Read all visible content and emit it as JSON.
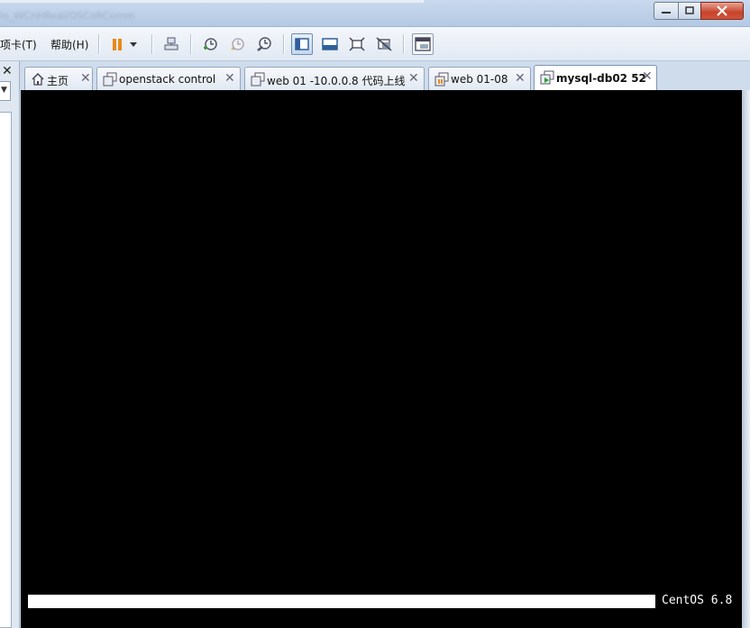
{
  "window": {
    "title": "lo_WCnHReal/OSCoRComm",
    "controls": {
      "minimize": "minimize",
      "maximize": "maximize",
      "close": "close"
    }
  },
  "menu": {
    "tabs_label": "项卡(T)",
    "help_label": "帮助(H)"
  },
  "toolbar": {
    "icons": [
      "pause-icon",
      "dropdown-arrow-icon",
      "send-ctrl-alt-del-icon",
      "snapshot-take-icon",
      "snapshot-revert-icon",
      "snapshot-manager-icon",
      "show-library-icon",
      "fullscreen-bar-icon",
      "fit-window-icon",
      "unity-icon",
      "console-view-icon"
    ]
  },
  "leftpane": {
    "close_glyph": "✕",
    "dropdown_glyph": "▼"
  },
  "tabs": [
    {
      "label": "主页",
      "icon": "home-icon",
      "close": "✕",
      "active": false
    },
    {
      "label": "openstack  control",
      "icon": "vm-icon",
      "close": "✕",
      "active": false
    },
    {
      "label": "web 01 -10.0.0.8  代码上线",
      "icon": "vm-icon",
      "close": "✕",
      "active": false
    },
    {
      "label": "web  01-08",
      "icon": "vm-paused-icon",
      "close": "✕",
      "active": false
    },
    {
      "label": "mysql-db02  52",
      "icon": "vm-running-icon",
      "close": "✕",
      "active": true
    }
  ],
  "console": {
    "boot_progress": 1.0,
    "os_label": "CentOS 6.8"
  },
  "colors": {
    "console_bg": "#000000",
    "accent": "#6a8cb8",
    "pause_orange": "#e88a1a"
  }
}
